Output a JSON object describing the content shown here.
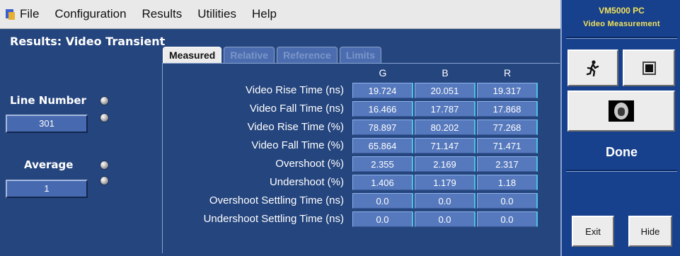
{
  "menu": {
    "items": [
      {
        "label": "File"
      },
      {
        "label": "Configuration"
      },
      {
        "label": "Results"
      },
      {
        "label": "Utilities"
      },
      {
        "label": "Help"
      }
    ]
  },
  "left": {
    "title": "Results: Video Transient",
    "line_number_label": "Line Number",
    "line_number_value": "301",
    "average_label": "Average",
    "average_value": "1"
  },
  "tabs": [
    {
      "label": "Measured",
      "active": true
    },
    {
      "label": "Relative",
      "active": false
    },
    {
      "label": "Reference",
      "active": false
    },
    {
      "label": "Limits",
      "active": false
    }
  ],
  "table": {
    "columns": [
      "G",
      "B",
      "R"
    ],
    "rows": [
      {
        "label": "Video Rise Time (ns)",
        "values": [
          "19.724",
          "20.051",
          "19.317"
        ]
      },
      {
        "label": "Video Fall Time (ns)",
        "values": [
          "16.466",
          "17.787",
          "17.868"
        ]
      },
      {
        "label": "Video Rise Time (%)",
        "values": [
          "78.897",
          "80.202",
          "77.268"
        ]
      },
      {
        "label": "Video Fall Time (%)",
        "values": [
          "65.864",
          "71.147",
          "71.471"
        ]
      },
      {
        "label": "Overshoot (%)",
        "values": [
          "2.355",
          "2.169",
          "2.317"
        ]
      },
      {
        "label": "Undershoot (%)",
        "values": [
          "1.406",
          "1.179",
          "1.18"
        ]
      },
      {
        "label": "Overshoot Settling Time (ns)",
        "values": [
          "0.0",
          "0.0",
          "0.0"
        ]
      },
      {
        "label": "Undershoot Settling Time (ns)",
        "values": [
          "0.0",
          "0.0",
          "0.0"
        ]
      }
    ]
  },
  "right": {
    "brand_line1": "VM5000 PC",
    "brand_line2": "Video Measurement",
    "status": "Done",
    "exit_label": "Exit",
    "hide_label": "Hide"
  },
  "colors": {
    "panel_bg": "#25457e",
    "cell_bg": "#5679bd",
    "right_bg": "#18418d",
    "brand_text": "#f2e25a"
  },
  "icons": {
    "run": "running-man-icon",
    "stop": "stop-icon",
    "face": "face-image-icon"
  }
}
